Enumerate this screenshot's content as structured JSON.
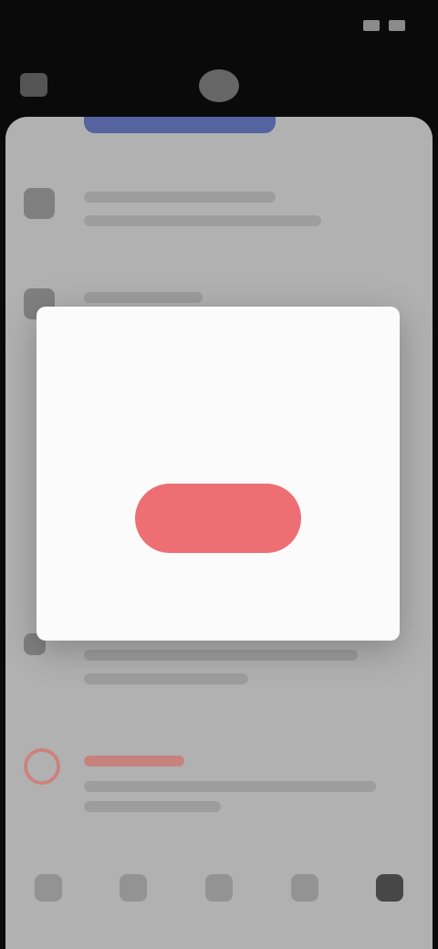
{
  "status_bar": {
    "time": "",
    "icons": [
      "signal-icon",
      "wifi-icon",
      "battery-icon"
    ]
  },
  "top_nav": {
    "left_icon": "back-icon",
    "center_icon": "avatar-icon"
  },
  "settings": {
    "rows": [
      {
        "title": "",
        "subtitle": ""
      },
      {
        "title": "",
        "subtitle": ""
      },
      {
        "title": "",
        "subtitle": ""
      }
    ],
    "danger_row": {
      "title": "",
      "subtitle": "",
      "color": "#c96a64"
    }
  },
  "tab_bar": {
    "tabs": [
      "home-icon",
      "search-icon",
      "add-icon",
      "notifications-icon",
      "profile-icon"
    ],
    "active_index": 4
  },
  "dialog": {
    "title": "",
    "body": "",
    "confirm_label": "",
    "cancel_label": "",
    "confirm_color": "#ee6f73"
  }
}
